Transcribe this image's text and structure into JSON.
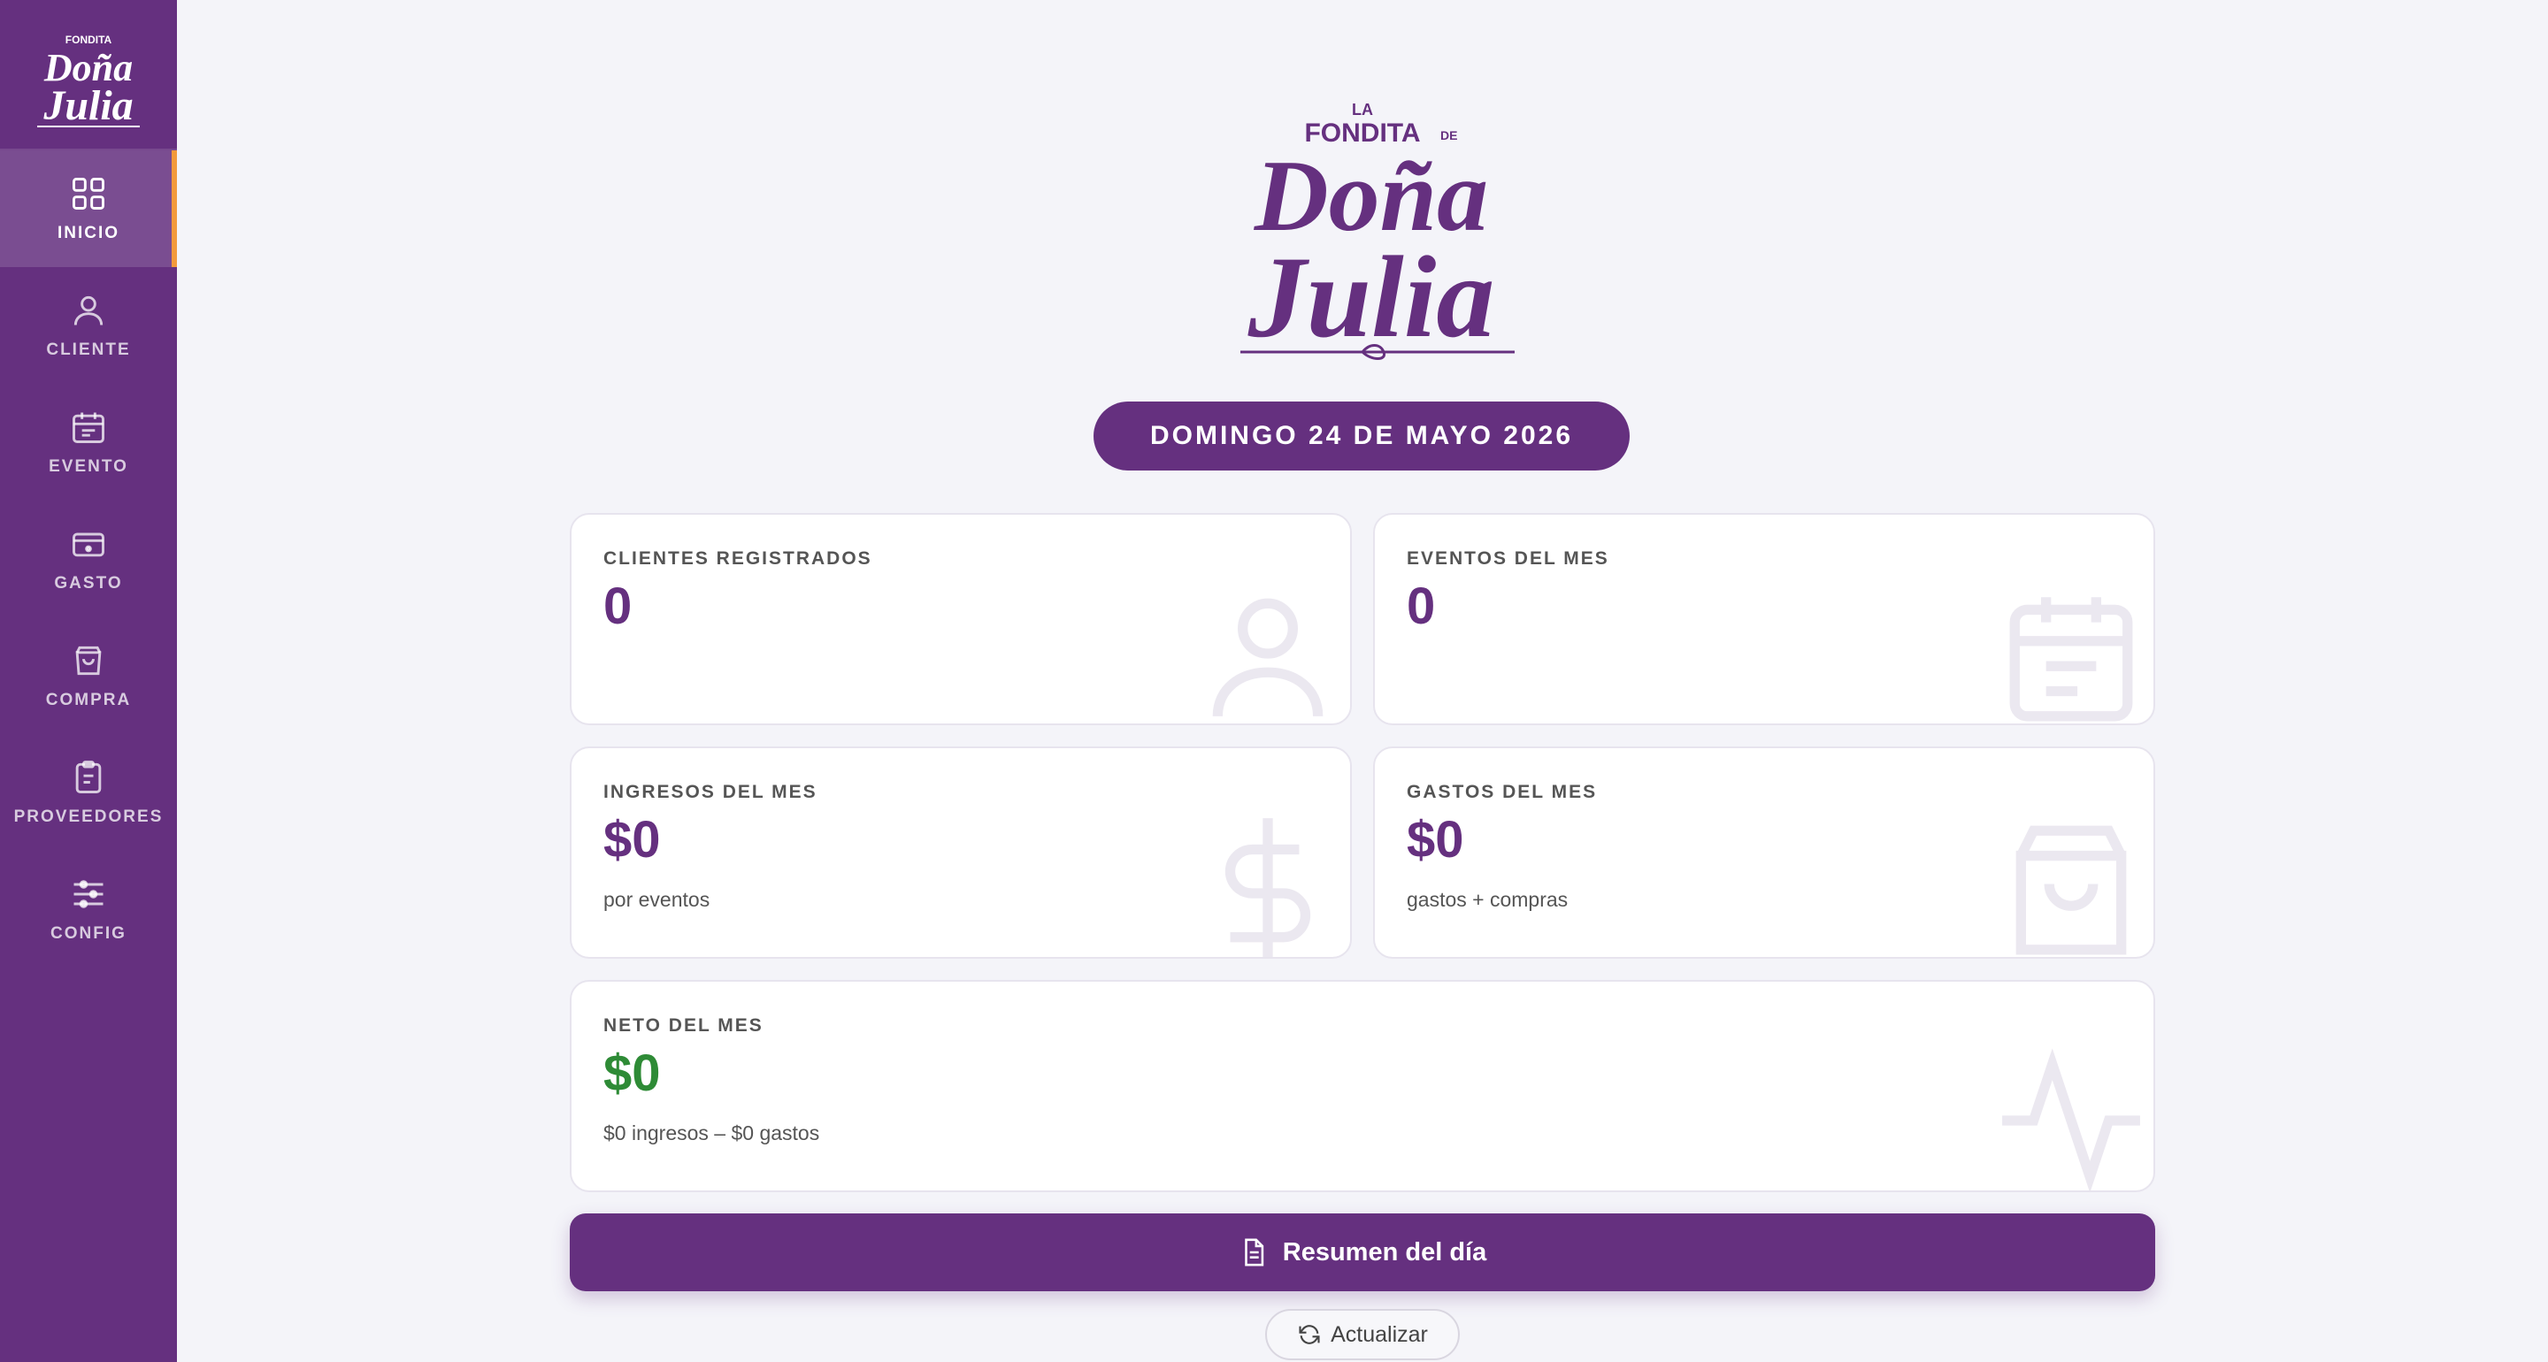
{
  "brand": {
    "prefix": "LA",
    "fondita": "FONDITA",
    "de": "DE",
    "line1": "Doña",
    "line2": "Julia",
    "color": "#65307f"
  },
  "sidebar": {
    "items": [
      {
        "label": "INICIO",
        "icon": "grid-icon",
        "active": true
      },
      {
        "label": "CLIENTE",
        "icon": "user-icon",
        "active": false
      },
      {
        "label": "EVENTO",
        "icon": "calendar-icon",
        "active": false
      },
      {
        "label": "GASTO",
        "icon": "card-icon",
        "active": false
      },
      {
        "label": "COMPRA",
        "icon": "bag-icon",
        "active": false
      },
      {
        "label": "PROVEEDORES",
        "icon": "clipboard-icon",
        "active": false
      },
      {
        "label": "CONFIG",
        "icon": "sliders-icon",
        "active": false
      }
    ],
    "accent": "#f39a3c"
  },
  "date": "DOMINGO 24 DE MAYO 2026",
  "cards": {
    "clientes": {
      "title": "CLIENTES REGISTRADOS",
      "value": "0",
      "icon": "user-icon"
    },
    "eventos": {
      "title": "EVENTOS DEL MES",
      "value": "0",
      "icon": "calendar-icon"
    },
    "ingresos": {
      "title": "INGRESOS DEL MES",
      "value": "$0",
      "sub": "por eventos",
      "icon": "dollar-icon"
    },
    "gastos": {
      "title": "GASTOS DEL MES",
      "value": "$0",
      "sub": "gastos + compras",
      "icon": "bag-icon"
    },
    "neto": {
      "title": "NETO DEL MES",
      "value": "$0",
      "sub": "$0 ingresos – $0 gastos",
      "icon": "pulse-icon"
    }
  },
  "actions": {
    "summary_label": "Resumen del día",
    "refresh_label": "Actualizar"
  },
  "colors": {
    "primary": "#65307f",
    "positive": "#2e8b36",
    "background": "#f4f4f9"
  }
}
